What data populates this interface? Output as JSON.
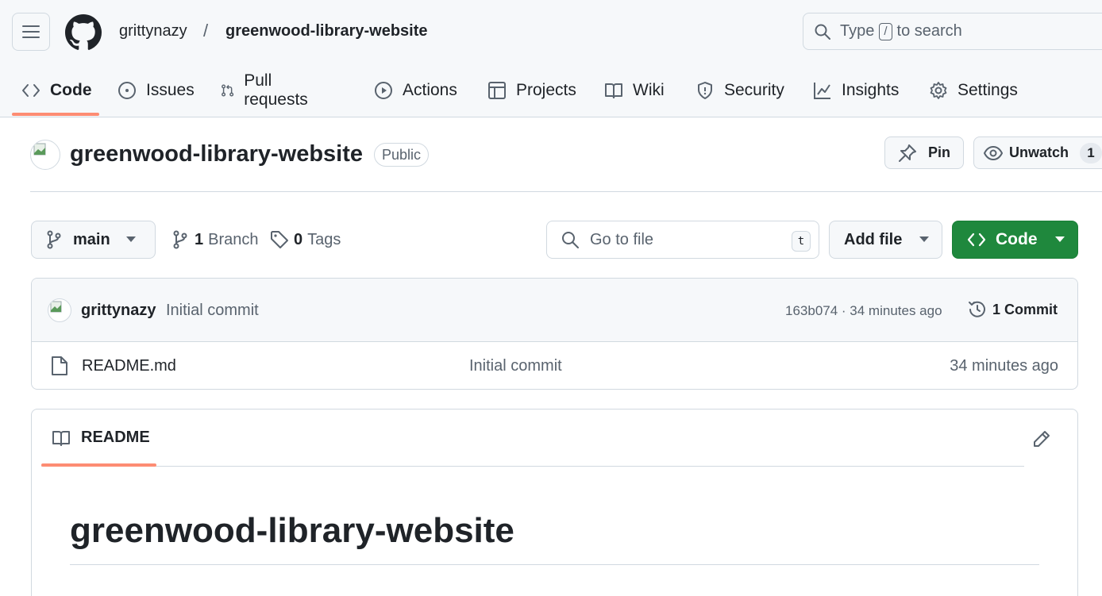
{
  "header": {
    "owner": "grittynazy",
    "separator": "/",
    "repo": "greenwood-library-website",
    "search": {
      "prefix": "Type",
      "key": "/",
      "suffix": "to search"
    }
  },
  "tabs": [
    {
      "label": "Code",
      "icon": "code-icon",
      "active": true
    },
    {
      "label": "Issues",
      "icon": "issue-icon"
    },
    {
      "label": "Pull requests",
      "icon": "pull-request-icon"
    },
    {
      "label": "Actions",
      "icon": "play-icon"
    },
    {
      "label": "Projects",
      "icon": "table-icon"
    },
    {
      "label": "Wiki",
      "icon": "book-icon"
    },
    {
      "label": "Security",
      "icon": "shield-icon"
    },
    {
      "label": "Insights",
      "icon": "graph-icon"
    },
    {
      "label": "Settings",
      "icon": "gear-icon"
    }
  ],
  "repo_header": {
    "title": "greenwood-library-website",
    "visibility": "Public",
    "pin_label": "Pin",
    "unwatch_label": "Unwatch",
    "watch_count": "1"
  },
  "branch_bar": {
    "branch": "main",
    "branch_count": "1",
    "branch_label": "Branch",
    "tag_count": "0",
    "tag_label": "Tags",
    "goto_placeholder": "Go to file",
    "goto_key": "t",
    "add_file_label": "Add file",
    "code_label": "Code"
  },
  "latest_commit": {
    "author": "grittynazy",
    "message": "Initial commit",
    "hash_time": "163b074 · 34 minutes ago",
    "commit_count_label": "1 Commit"
  },
  "files": [
    {
      "name": "README.md",
      "commit": "Initial commit",
      "time": "34 minutes ago"
    }
  ],
  "readme": {
    "tab_label": "README",
    "heading": "greenwood-library-website"
  },
  "colors": {
    "accent_underline": "#fd8c73",
    "code_button": "#1f883d",
    "header_bg": "#f6f8fa",
    "border": "#d1d9e0"
  }
}
